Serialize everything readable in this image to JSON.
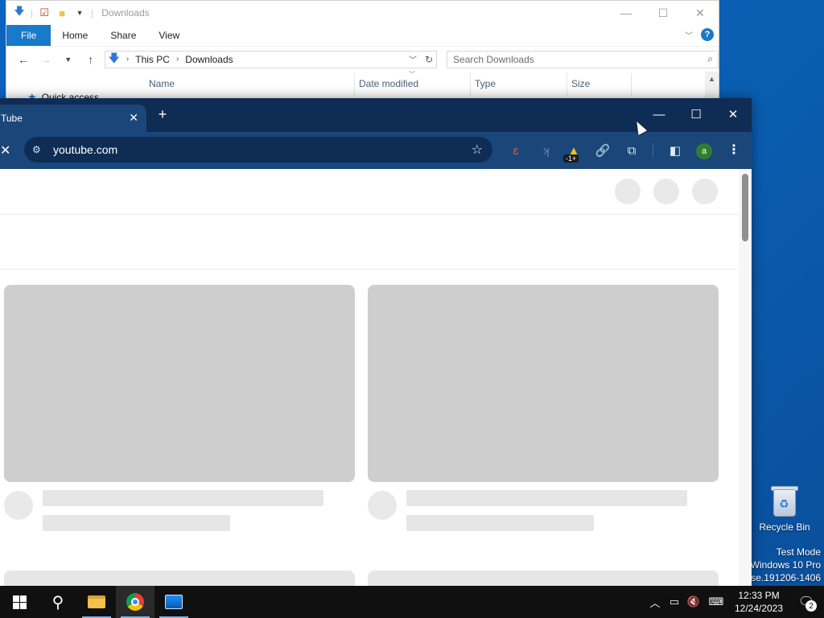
{
  "explorer": {
    "title": "Downloads",
    "ribbon": {
      "file": "File",
      "home": "Home",
      "share": "Share",
      "view": "View"
    },
    "address": {
      "root": "This PC",
      "current": "Downloads"
    },
    "search": {
      "placeholder": "Search Downloads"
    },
    "columns": {
      "name": "Name",
      "date": "Date modified",
      "type": "Type",
      "size": "Size"
    },
    "nav": {
      "quick_access": "Quick access"
    },
    "window_controls": {
      "minimize": "—",
      "maximize": "☐",
      "close": "✕"
    }
  },
  "chrome": {
    "tab": {
      "title": "Tube",
      "close": "✕"
    },
    "new_tab": "+",
    "window_controls": {
      "minimize": "—",
      "maximize": "☐",
      "close": "✕"
    },
    "stop": "✕",
    "omnibox": {
      "url": "youtube.com"
    },
    "profile_initial": "a",
    "extension_badge": "-1+"
  },
  "desktop": {
    "recycle_bin": "Recycle Bin",
    "watermark": {
      "line1": "Test Mode",
      "line2": "Windows 10 Pro",
      "line3": "ase.191206-1406"
    }
  },
  "taskbar": {
    "clock": {
      "time": "12:33 PM",
      "date": "12/24/2023"
    },
    "notifications": "2"
  },
  "colors": {
    "chrome_frame": "#0f2d54",
    "chrome_toolbar": "#1a4679",
    "ribbon_file": "#1979ca",
    "desktop": "#0a5fb3",
    "skeleton": "#cecece"
  }
}
